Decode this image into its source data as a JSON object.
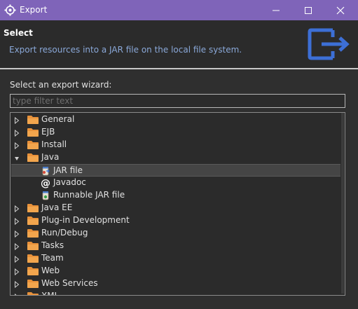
{
  "window": {
    "title": "Export",
    "accent": "#7f64b9"
  },
  "header": {
    "title": "Select",
    "description": "Export resources into a JAR file on the local file system."
  },
  "wizard": {
    "label": "Select an export wizard:",
    "filter_placeholder": "type filter text",
    "filter_value": ""
  },
  "tree": {
    "items": [
      {
        "label": "General",
        "expanded": false,
        "icon": "folder-icon"
      },
      {
        "label": "EJB",
        "expanded": false,
        "icon": "folder-icon"
      },
      {
        "label": "Install",
        "expanded": false,
        "icon": "folder-icon"
      },
      {
        "label": "Java",
        "expanded": true,
        "icon": "folder-icon"
      },
      {
        "label": "JAR file",
        "icon": "jar-file-icon",
        "selected": true
      },
      {
        "label": "Javadoc",
        "icon": "javadoc-at-icon"
      },
      {
        "label": "Runnable JAR file",
        "icon": "runnable-jar-icon"
      },
      {
        "label": "Java EE",
        "expanded": false,
        "icon": "folder-icon"
      },
      {
        "label": "Plug-in Development",
        "expanded": false,
        "icon": "folder-icon"
      },
      {
        "label": "Run/Debug",
        "expanded": false,
        "icon": "folder-icon"
      },
      {
        "label": "Tasks",
        "expanded": false,
        "icon": "folder-icon"
      },
      {
        "label": "Team",
        "expanded": false,
        "icon": "folder-icon"
      },
      {
        "label": "Web",
        "expanded": false,
        "icon": "folder-icon"
      },
      {
        "label": "Web Services",
        "expanded": false,
        "icon": "folder-icon"
      },
      {
        "label": "XML",
        "expanded": false,
        "icon": "folder-icon"
      }
    ]
  }
}
